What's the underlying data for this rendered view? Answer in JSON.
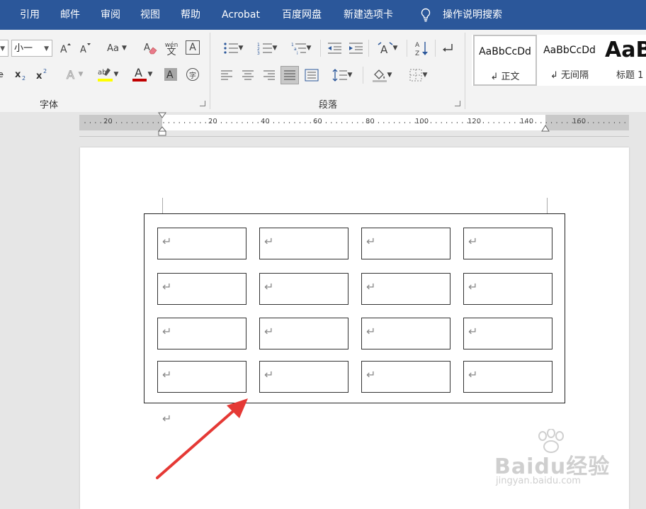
{
  "menu": {
    "items": [
      "引用",
      "邮件",
      "审阅",
      "视图",
      "帮助",
      "Acrobat",
      "百度网盘",
      "新建选项卡",
      "操作说明搜索"
    ]
  },
  "ribbon": {
    "font_size_value": "小一",
    "font_group_label": "字体",
    "paragraph_group_label": "段落",
    "change_case_label": "Aa",
    "phonetic_top": "wén",
    "phonetic_bottom": "文",
    "border_char_label": "A",
    "enclose_char_label": "字",
    "styles": [
      {
        "sample": "AaBbCcDd",
        "name": "↲ 正文",
        "selected": true
      },
      {
        "sample": "AaBbCcDd",
        "name": "↲ 无间隔",
        "selected": false
      },
      {
        "sample": "AaB",
        "name": "标题 1",
        "selected": false
      }
    ]
  },
  "ruler": {
    "labels": [
      "20",
      "20",
      "40",
      "60",
      "80",
      "100",
      "120",
      "140",
      "160"
    ]
  },
  "document": {
    "paragraph_mark": "↵",
    "table": {
      "rows": 4,
      "cols": 4
    }
  },
  "watermark": {
    "brand": "Baidu经验",
    "url": "jingyan.baidu.com"
  },
  "colors": {
    "menubar_bg": "#2b579a",
    "highlight_color": "#ffff00",
    "font_color": "#c00000",
    "arrow_color": "#e53935"
  }
}
